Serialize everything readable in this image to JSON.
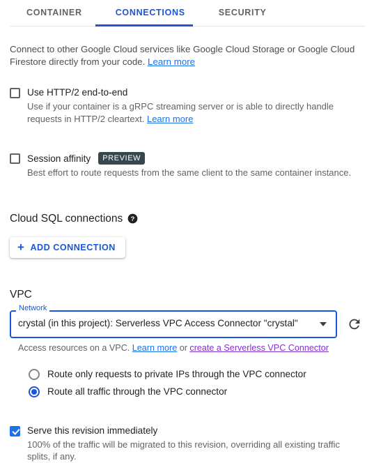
{
  "tabs": [
    {
      "label": "CONTAINER",
      "active": false
    },
    {
      "label": "CONNECTIONS",
      "active": true
    },
    {
      "label": "SECURITY",
      "active": false
    }
  ],
  "intro": {
    "text": "Connect to other Google Cloud services like Google Cloud Storage or Google Cloud Firestore directly from your code.",
    "link": "Learn more"
  },
  "http2": {
    "label": "Use HTTP/2 end-to-end",
    "description": "Use if your container is a gRPC streaming server or is able to directly handle requests in HTTP/2 cleartext.",
    "link": "Learn more",
    "checked": false
  },
  "session_affinity": {
    "label": "Session affinity",
    "badge": "PREVIEW",
    "description": "Best effort to route requests from the same client to the same container instance.",
    "checked": false
  },
  "cloud_sql": {
    "heading": "Cloud SQL connections",
    "help_icon": "help-icon",
    "add_button": "ADD CONNECTION",
    "add_icon": "plus-icon"
  },
  "vpc": {
    "heading": "VPC",
    "network_label": "Network",
    "network_value": "crystal (in this project): Serverless VPC Access Connector \"crystal\"",
    "dropdown_icon": "chevron-down-icon",
    "refresh_icon": "refresh-icon",
    "help_prefix": "Access resources on a VPC.",
    "help_link": "Learn more",
    "help_conjunction": "or",
    "help_link_visited": "create a Serverless VPC Connector",
    "routing_options": [
      {
        "label": "Route only requests to private IPs through the VPC connector",
        "selected": false
      },
      {
        "label": "Route all traffic through the VPC connector",
        "selected": true
      }
    ]
  },
  "serve_revision": {
    "label": "Serve this revision immediately",
    "description": "100% of the traffic will be migrated to this revision, overriding all existing traffic splits, if any.",
    "checked": true
  },
  "colors": {
    "accent_blue": "#1a56db",
    "link_blue": "#1a73e8",
    "visited_purple": "#8430ce",
    "badge_bg": "#37474f"
  }
}
